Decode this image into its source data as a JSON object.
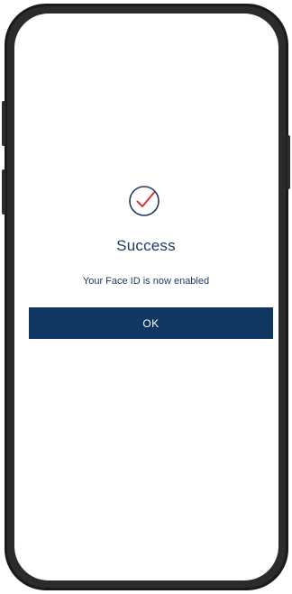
{
  "dialog": {
    "icon": "check-circle-icon",
    "title": "Success",
    "message": "Your Face ID is now enabled",
    "ok_label": "OK"
  },
  "colors": {
    "primary": "#0f3762",
    "text": "#1f3b63",
    "check_accent": "#e0303b"
  }
}
